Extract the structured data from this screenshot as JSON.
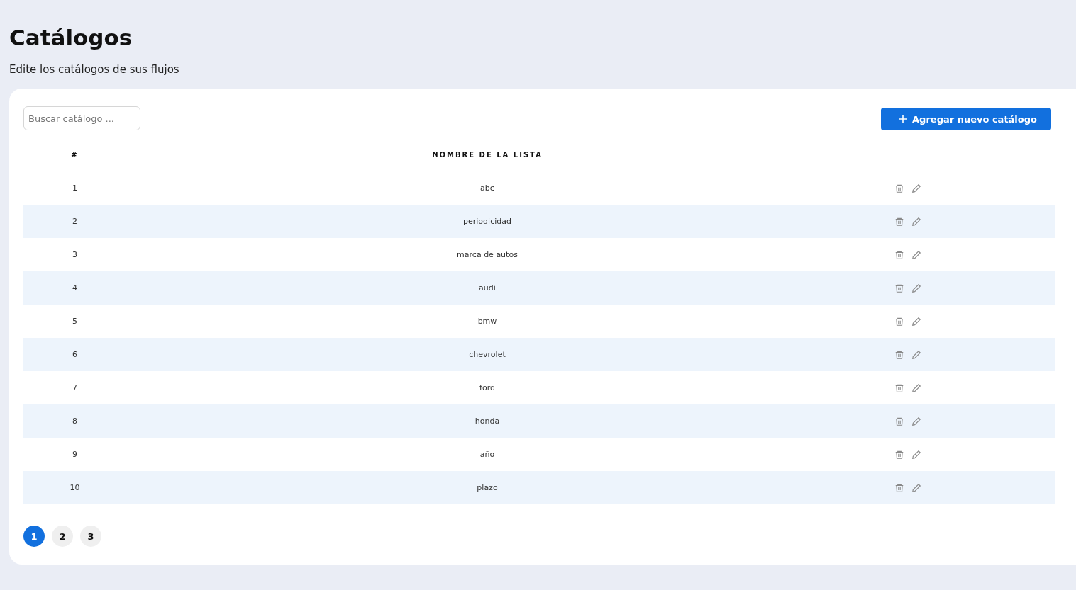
{
  "title": "Catálogos",
  "subtitle": "Edite los catálogos de sus flujos",
  "search": {
    "placeholder": "Buscar catálogo ..."
  },
  "add_button": {
    "label": "Agregar nuevo catálogo"
  },
  "table": {
    "columns": [
      "#",
      "NOMBRE DE LA LISTA"
    ],
    "rows": [
      {
        "index": "1",
        "name": "abc"
      },
      {
        "index": "2",
        "name": "periodicidad"
      },
      {
        "index": "3",
        "name": "marca de autos"
      },
      {
        "index": "4",
        "name": "audi"
      },
      {
        "index": "5",
        "name": "bmw"
      },
      {
        "index": "6",
        "name": "chevrolet"
      },
      {
        "index": "7",
        "name": "ford"
      },
      {
        "index": "8",
        "name": "honda"
      },
      {
        "index": "9",
        "name": "año"
      },
      {
        "index": "10",
        "name": "plazo"
      }
    ]
  },
  "pagination": [
    {
      "label": "1",
      "selected": true
    },
    {
      "label": "2",
      "selected": false
    },
    {
      "label": "3",
      "selected": false
    }
  ]
}
